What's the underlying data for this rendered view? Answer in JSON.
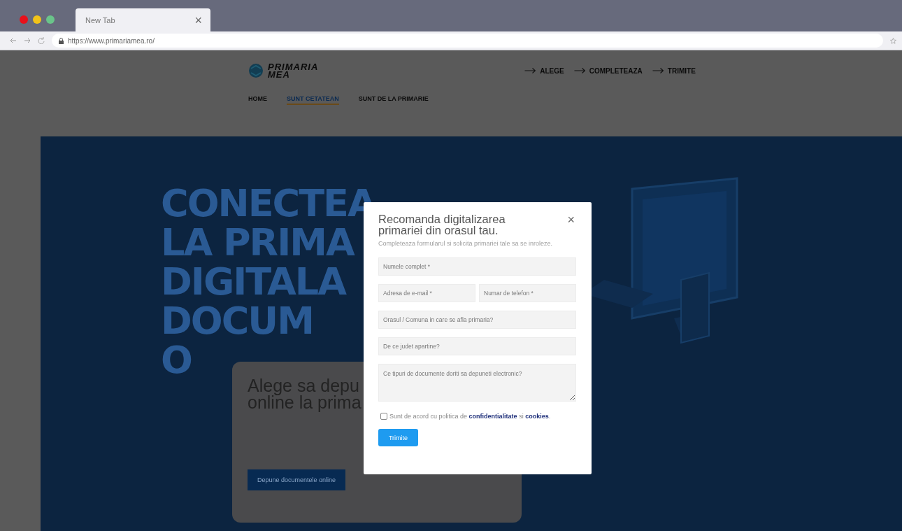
{
  "browser": {
    "tab_title": "New Tab",
    "close": "×",
    "url": "https://www.primariamea.ro/"
  },
  "site": {
    "logo_lines": [
      "PRIMARIA",
      "MEA"
    ],
    "steps": [
      {
        "label": "ALEGE"
      },
      {
        "label": "COMPLETEAZA"
      },
      {
        "label": "TRIMITE"
      }
    ],
    "nav": [
      {
        "label": "HOME",
        "selected": false
      },
      {
        "label": "SUNT CETATEAN",
        "selected": true
      },
      {
        "label": "SUNT DE LA PRIMARIE",
        "selected": false
      }
    ]
  },
  "hero": {
    "headline_lines": [
      "CONECTEA",
      "LA PRIMA",
      "DIGITALA",
      "DOCUM",
      "O"
    ],
    "card": {
      "title_lines": [
        "Alege sa depu",
        "online la prima"
      ],
      "button": "Depune documentele online"
    }
  },
  "modal": {
    "title": "Recomanda digitalizarea primariei din orasul tau.",
    "subtitle": "Completeaza formularul si solicita primariei tale sa se inroleze.",
    "close": "×",
    "rows": [
      {
        "fields": [
          {
            "kind": "input",
            "placeholder": "Numele complet *"
          }
        ]
      },
      {
        "fields": [
          {
            "kind": "input",
            "placeholder": "Adresa de e-mail *"
          },
          {
            "kind": "input",
            "placeholder": "Numar de telefon *"
          }
        ]
      },
      {
        "fields": [
          {
            "kind": "input",
            "placeholder": "Orasul / Comuna in care se afla primaria?"
          }
        ]
      },
      {
        "fields": [
          {
            "kind": "input",
            "placeholder": "De ce judet apartine?"
          }
        ]
      },
      {
        "fields": [
          {
            "kind": "textarea",
            "placeholder": "Ce tipuri de documente doriti sa depuneti electronic?"
          }
        ]
      }
    ],
    "consent": {
      "checked": false,
      "parts": [
        {
          "kind": "text",
          "text": "Sunt de acord cu politica de"
        },
        {
          "kind": "link",
          "text": "confidentialitate"
        },
        {
          "kind": "text",
          "text": "si"
        },
        {
          "kind": "link",
          "text": "cookies"
        },
        {
          "kind": "text",
          "text": "."
        }
      ]
    },
    "submit": "Trimite"
  }
}
